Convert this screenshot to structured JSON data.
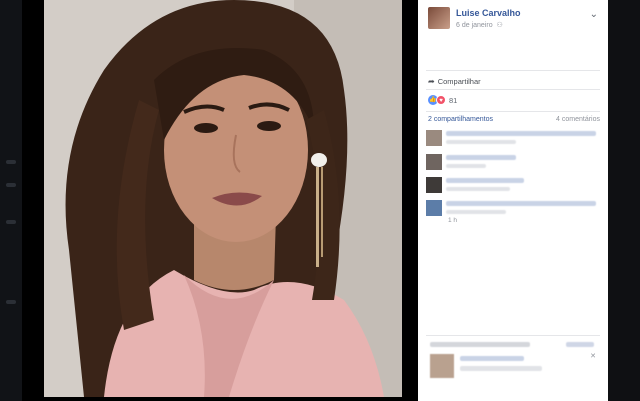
{
  "post": {
    "author_name": "Luise Carvalho",
    "date": "6 de janeiro",
    "privacy_icon": "friends-icon",
    "menu_icon": "chevron-down-icon"
  },
  "actions": {
    "share_label": "Compartilhar",
    "share_icon": "share-arrow-icon"
  },
  "reactions": {
    "count": "81",
    "types": [
      "like",
      "love"
    ],
    "like_color": "#5890ff",
    "love_color": "#f25268"
  },
  "stats": {
    "shares": "2 compartilhamentos",
    "comments": "4 comentários"
  },
  "comments": {
    "time": "1 h"
  },
  "colors": {
    "link": "#365899",
    "muted": "#90949c",
    "background": "#0b0b0c"
  }
}
